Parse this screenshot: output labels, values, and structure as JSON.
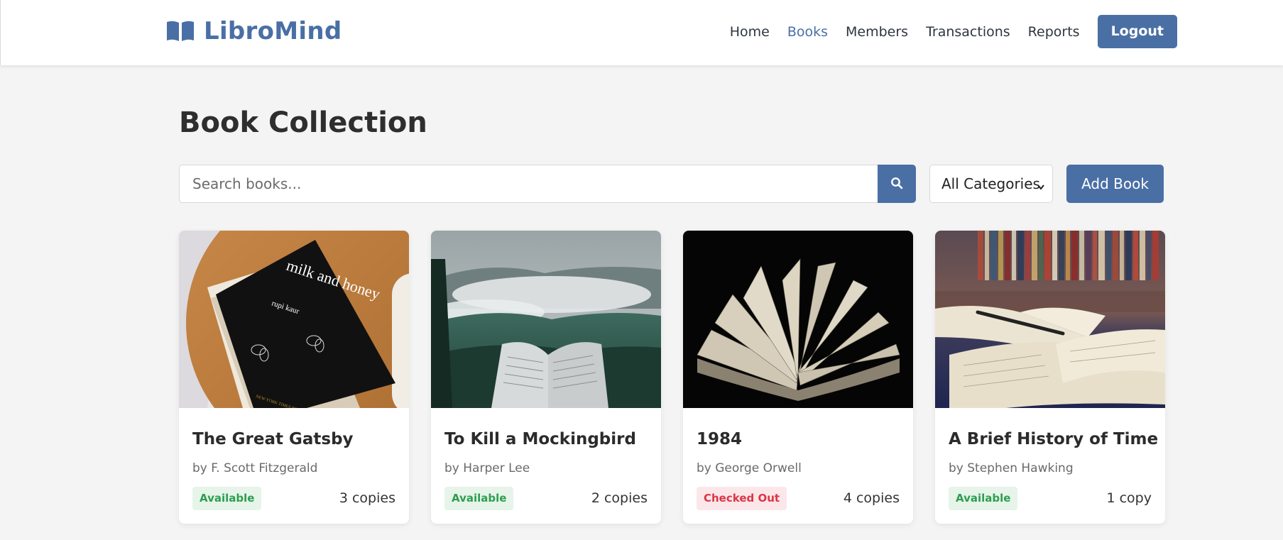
{
  "app": {
    "name": "LibroMind",
    "logo_icon": "open-book-icon",
    "brand_color": "#4a6fa5"
  },
  "nav": {
    "items": [
      {
        "label": "Home",
        "active": false
      },
      {
        "label": "Books",
        "active": true
      },
      {
        "label": "Members",
        "active": false
      },
      {
        "label": "Transactions",
        "active": false
      },
      {
        "label": "Reports",
        "active": false
      }
    ],
    "logout_label": "Logout"
  },
  "page": {
    "title": "Book Collection"
  },
  "search": {
    "placeholder": "Search books...",
    "value": "",
    "button_icon": "search-icon"
  },
  "category_filter": {
    "selected": "All Categories"
  },
  "add_book_label": "Add Book",
  "books": [
    {
      "title": "The Great Gatsby",
      "author": "by F. Scott Fitzgerald",
      "status": "Available",
      "status_type": "available",
      "copies": "3 copies"
    },
    {
      "title": "To Kill a Mockingbird",
      "author": "by Harper Lee",
      "status": "Available",
      "status_type": "available",
      "copies": "2 copies"
    },
    {
      "title": "1984",
      "author": "by George Orwell",
      "status": "Checked Out",
      "status_type": "out",
      "copies": "4 copies"
    },
    {
      "title": "A Brief History of Time",
      "author": "by Stephen Hawking",
      "status": "Available",
      "status_type": "available",
      "copies": "1 copy"
    }
  ],
  "cover_art": {
    "book_title_text": "milk and honey",
    "book_author_text": "rupi kaur",
    "book_footer_text": "NEW YORK TIMES BESTSELLER"
  }
}
